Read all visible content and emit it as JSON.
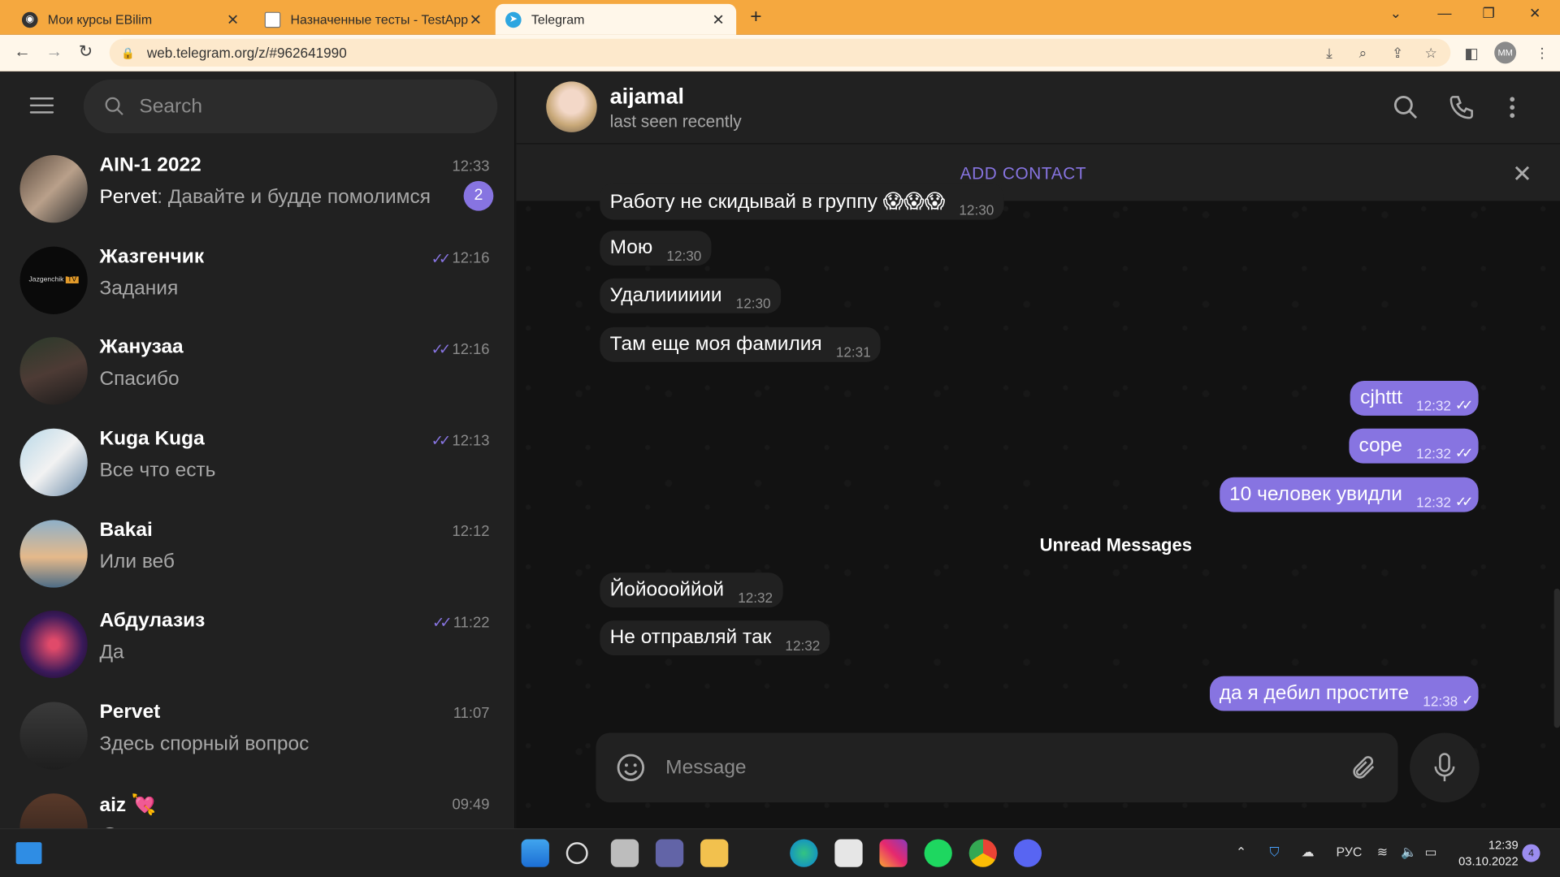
{
  "browser": {
    "tabs": [
      {
        "title": "Мои курсы EBilim",
        "close": "✕"
      },
      {
        "title": "Назначенные тесты - TestApp",
        "close": "✕"
      },
      {
        "title": "Telegram",
        "close": "✕"
      }
    ],
    "new_tab": "+",
    "url": "web.telegram.org/z/#962641990",
    "profile": "MM",
    "window_controls": {
      "dropdown": "⌄",
      "minimize": "—",
      "maximize": "❐",
      "close": "✕"
    },
    "nav": {
      "back": "←",
      "forward": "→",
      "reload": "↻"
    }
  },
  "sidebar": {
    "search_placeholder": "Search",
    "chats": [
      {
        "name": "AIN-1 2022",
        "sender": "Pervet",
        "preview": ": Давайте и будде помолимся",
        "time": "12:33",
        "unread": "2",
        "read": false
      },
      {
        "name": "Жазгенчик",
        "sender": "",
        "preview": "Задания",
        "time": "12:16",
        "read": true
      },
      {
        "name": "Жанузаа",
        "sender": "",
        "preview": "Спасибо",
        "time": "12:16",
        "read": true
      },
      {
        "name": "Kuga Kuga",
        "sender": "",
        "preview": "Все что есть",
        "time": "12:13",
        "read": true
      },
      {
        "name": "Bakai",
        "sender": "",
        "preview": "Или веб",
        "time": "12:12",
        "read": false
      },
      {
        "name": "Абдулазиз",
        "sender": "",
        "preview": "Да",
        "time": "11:22",
        "read": true
      },
      {
        "name": "Pervet",
        "sender": "",
        "preview": "Здесь спорный вопрос",
        "time": "11:07",
        "read": false
      },
      {
        "name": "aiz 💘",
        "sender": "",
        "preview": "😊",
        "time": "09:49",
        "read": false
      }
    ]
  },
  "chat": {
    "name": "aijamal",
    "status": "last seen recently",
    "add_contact": "ADD CONTACT",
    "unread_divider": "Unread Messages",
    "messages": [
      {
        "dir": "in",
        "text": "Работу не скидывай в группу 😱😱😱",
        "time": "12:30"
      },
      {
        "dir": "in",
        "text": "Мою",
        "time": "12:30"
      },
      {
        "dir": "in",
        "text": "Удалииииии",
        "time": "12:30"
      },
      {
        "dir": "in",
        "text": "Там еще моя фамилия",
        "time": "12:31"
      },
      {
        "dir": "out",
        "text": "cjhttt",
        "time": "12:32",
        "ticks": "✓✓"
      },
      {
        "dir": "out",
        "text": "соре",
        "time": "12:32",
        "ticks": "✓✓"
      },
      {
        "dir": "out",
        "text": "10 человек увидли",
        "time": "12:32",
        "ticks": "✓✓"
      },
      {
        "dir": "in",
        "text": "Йойоооййой",
        "time": "12:32"
      },
      {
        "dir": "in",
        "text": "Не отправляй так",
        "time": "12:32"
      },
      {
        "dir": "out",
        "text": "да я дебил простите",
        "time": "12:38",
        "ticks": "✓"
      }
    ],
    "composer_placeholder": "Message"
  },
  "taskbar": {
    "lang": "РУС",
    "time": "12:39",
    "date": "03.10.2022",
    "notifications": "4"
  },
  "colors": {
    "accent": "#8774e1",
    "tabbar": "#f5a83f"
  }
}
